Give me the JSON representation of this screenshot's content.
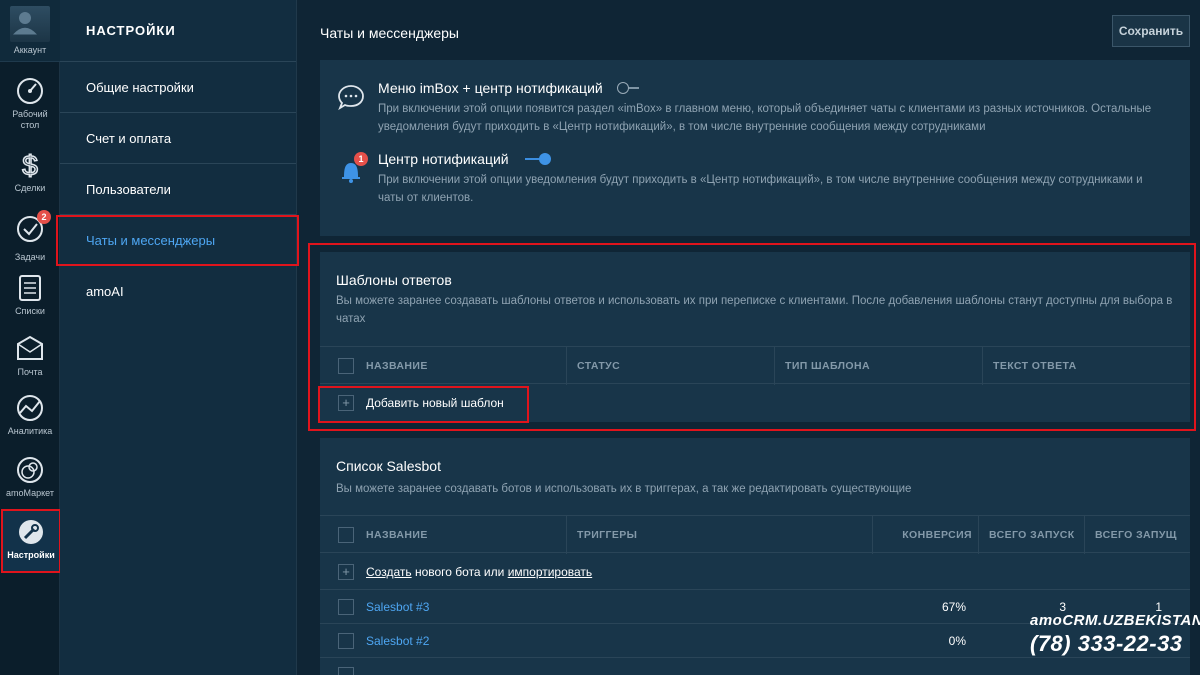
{
  "rail": {
    "account": "Аккаунт",
    "items": [
      {
        "label": "Рабочий стол",
        "icon": "dashboard-icon"
      },
      {
        "label": "Сделки",
        "icon": "dollar-icon"
      },
      {
        "label": "Задачи",
        "icon": "check-icon",
        "badge": "2"
      },
      {
        "label": "Списки",
        "icon": "list-icon"
      },
      {
        "label": "Почта",
        "icon": "mail-icon"
      },
      {
        "label": "Аналитика",
        "icon": "analytics-icon"
      },
      {
        "label": "amoМаркет",
        "icon": "market-icon"
      },
      {
        "label": "Настройки",
        "icon": "settings-icon"
      }
    ]
  },
  "menu": {
    "header": "НАСТРОЙКИ",
    "items": [
      "Общие настройки",
      "Счет и оплата",
      "Пользователи",
      "Чаты и мессенджеры",
      "amoAI"
    ]
  },
  "main": {
    "title": "Чаты и мессенджеры",
    "save_label": "Сохранить",
    "options": [
      {
        "title": "Меню imBox + центр нотификаций",
        "desc": "При включении этой опции появится раздел «imBox» в главном меню, который объединяет чаты с клиентами из разных источников. Остальные уведомления будут приходить в «Центр нотификаций», в том числе внутренние сообщения между сотрудниками",
        "enabled": false
      },
      {
        "title": "Центр нотификаций",
        "desc": "При включении этой опции уведомления будут приходить в «Центр нотификаций», в том числе внутренние сообщения между сотрудниками и чаты от клиентов.",
        "enabled": true,
        "badge": "1"
      }
    ],
    "templates": {
      "title": "Шаблоны ответов",
      "desc": "Вы можете заранее создавать шаблоны ответов и использовать их при переписке с клиентами. После добавления шаблоны станут доступны для выбора в чатах",
      "columns": [
        "НАЗВАНИЕ",
        "СТАТУС",
        "ТИП ШАБЛОНА",
        "ТЕКСТ ОТВЕТА"
      ],
      "add_label": "Добавить новый шаблон"
    },
    "salesbot": {
      "title": "Список Salesbot",
      "desc": "Вы можете заранее создавать ботов и использовать их в триггерах, а так же редактировать существующие",
      "columns": [
        "НАЗВАНИЕ",
        "ТРИГГЕРЫ",
        "КОНВЕРСИЯ",
        "ВСЕГО ЗАПУСК",
        "ВСЕГО ЗАПУЩ"
      ],
      "create_link": "Создать",
      "create_mid": " нового бота или ",
      "import_link": "импортировать",
      "rows": [
        {
          "name": "Salesbot #3",
          "conversion": "67%",
          "runs": "3",
          "runs2": "1"
        },
        {
          "name": "Salesbot #2",
          "conversion": "0%",
          "runs": "",
          "runs2": ""
        }
      ]
    }
  },
  "watermark": {
    "brand": "amoCRM.UZBEKISTAN",
    "phone": "(78) 333-22-33"
  },
  "colors": {
    "accent": "#4ea6f2",
    "highlight": "#e0141c",
    "badge": "#e5504a"
  }
}
